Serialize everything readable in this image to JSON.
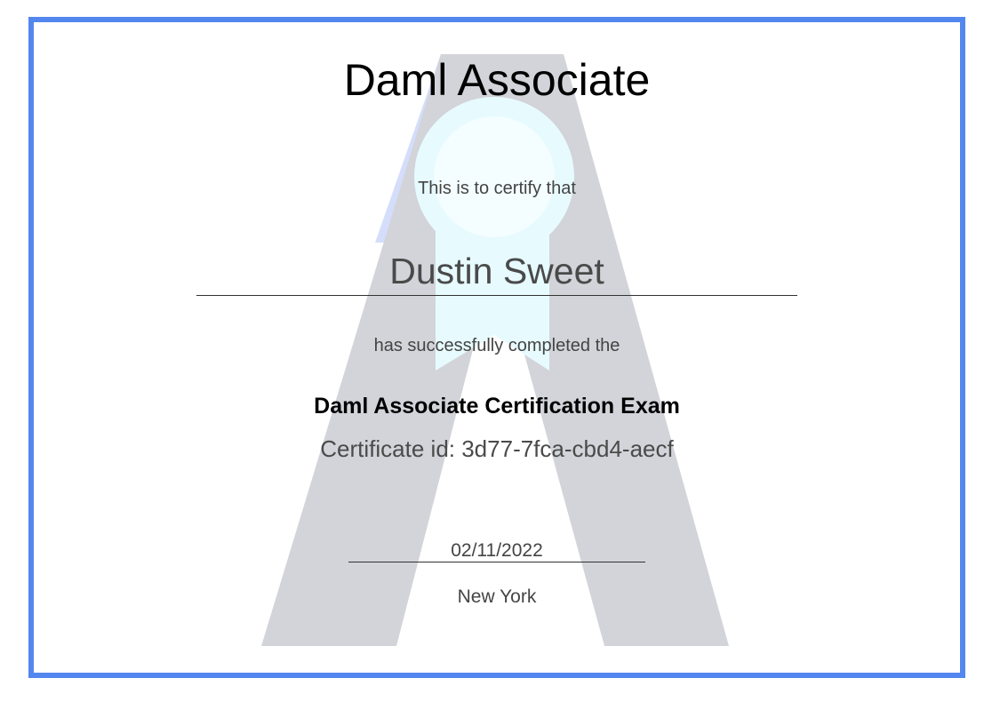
{
  "certificate": {
    "title": "Daml Associate",
    "certify_text": "This is to certify that",
    "recipient_name": "Dustin Sweet",
    "completed_text": "has successfully completed the",
    "exam_name": "Daml Associate Certification Exam",
    "certificate_id": "Certificate id: 3d77-7fca-cbd4-aecf",
    "date": "02/11/2022",
    "location": "New York"
  },
  "colors": {
    "border": "#5387ef",
    "watermark_gray": "#d2d4d9",
    "ribbon_blue": "#d4defb",
    "ribbon_cyan": "#e7fbff"
  }
}
